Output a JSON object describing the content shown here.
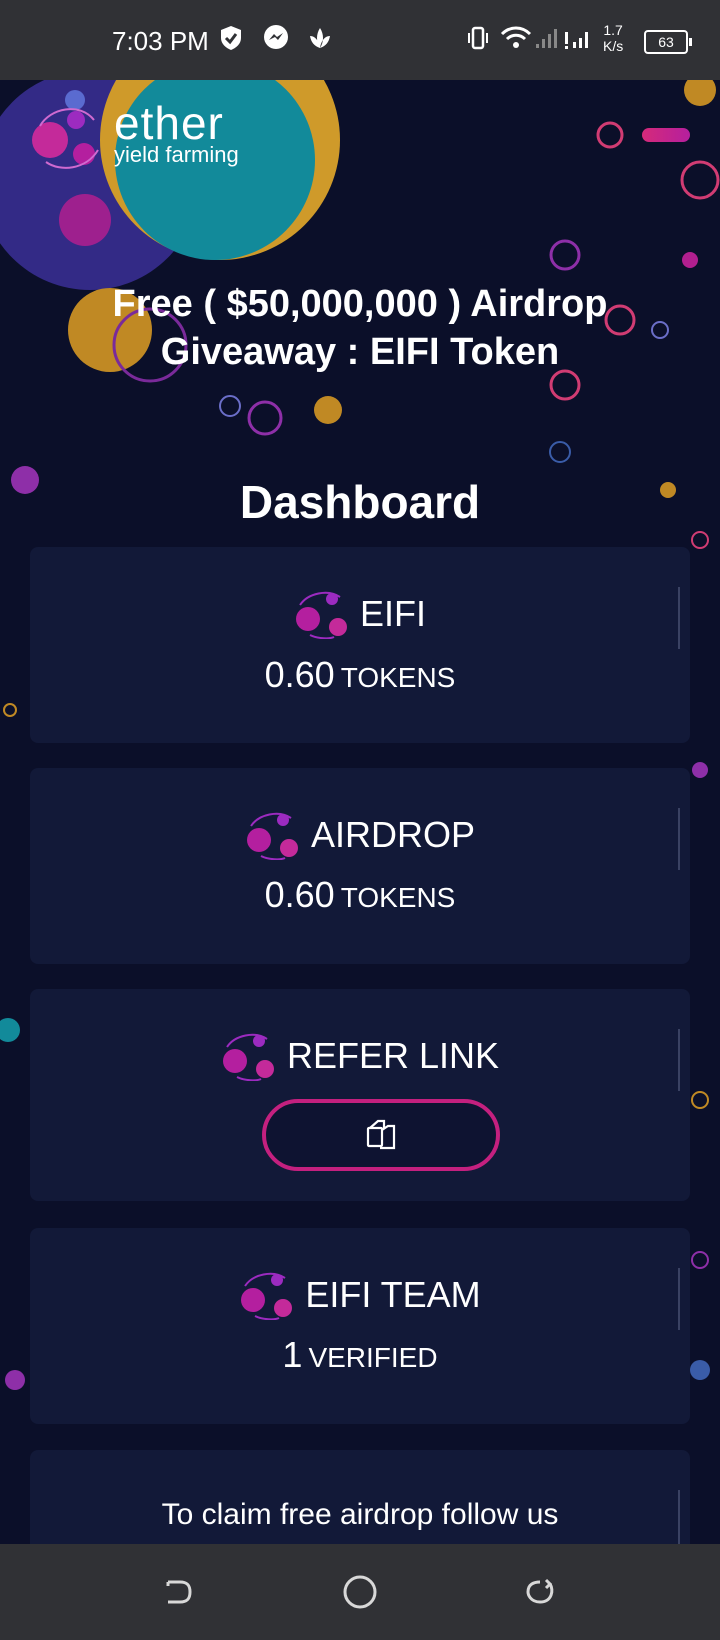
{
  "status_bar": {
    "time": "7:03 PM",
    "net_speed_value": "1.7",
    "net_speed_unit": "K/s",
    "battery": "63"
  },
  "brand": {
    "name": "ether",
    "subtitle": "yield farming"
  },
  "headline": "Free ( $50,000,000 ) Airdrop Giveaway : EIFI Token",
  "dashboard_title": "Dashboard",
  "cards": {
    "eifi": {
      "label": "EIFI",
      "value": "0.60",
      "unit": "TOKENS"
    },
    "airdrop": {
      "label": "AIRDROP",
      "value": "0.60",
      "unit": "TOKENS"
    },
    "refer": {
      "label": "REFER LINK"
    },
    "team": {
      "label": "EIFI TEAM",
      "value": "1",
      "unit": "VERIFIED"
    },
    "follow": {
      "text": "To claim free airdrop follow us"
    }
  },
  "icons": {
    "token": "eifi-logo-icon",
    "copy": "copy-icon",
    "back": "back-icon",
    "home": "home-icon",
    "recents": "recents-icon"
  },
  "colors": {
    "accent": "#b51f9e",
    "pink": "#d52a7a",
    "card_bg": "#121938",
    "page_bg": "#0b0f29"
  }
}
